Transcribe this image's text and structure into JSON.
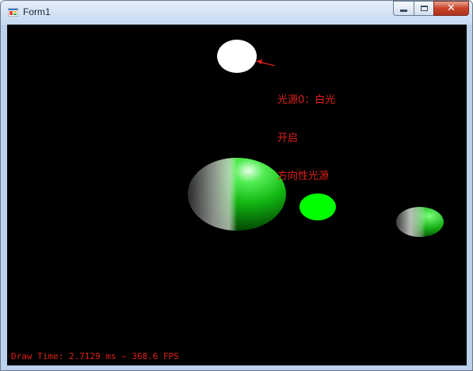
{
  "window": {
    "title": "Form1",
    "caption_buttons": [
      "minimize-icon",
      "maximize-icon",
      "close-icon"
    ]
  },
  "scene": {
    "background_color": "#000000",
    "light_source_color": "#ffffff",
    "sphere_highlight_color": "#00ff00",
    "annotation": {
      "line1": "光源0：白光",
      "line2": "开启",
      "line3": "方向性光源",
      "color": "#e0201a"
    }
  },
  "status": {
    "text": "Draw Time: 2.7129 ms ~ 368.6 FPS"
  }
}
